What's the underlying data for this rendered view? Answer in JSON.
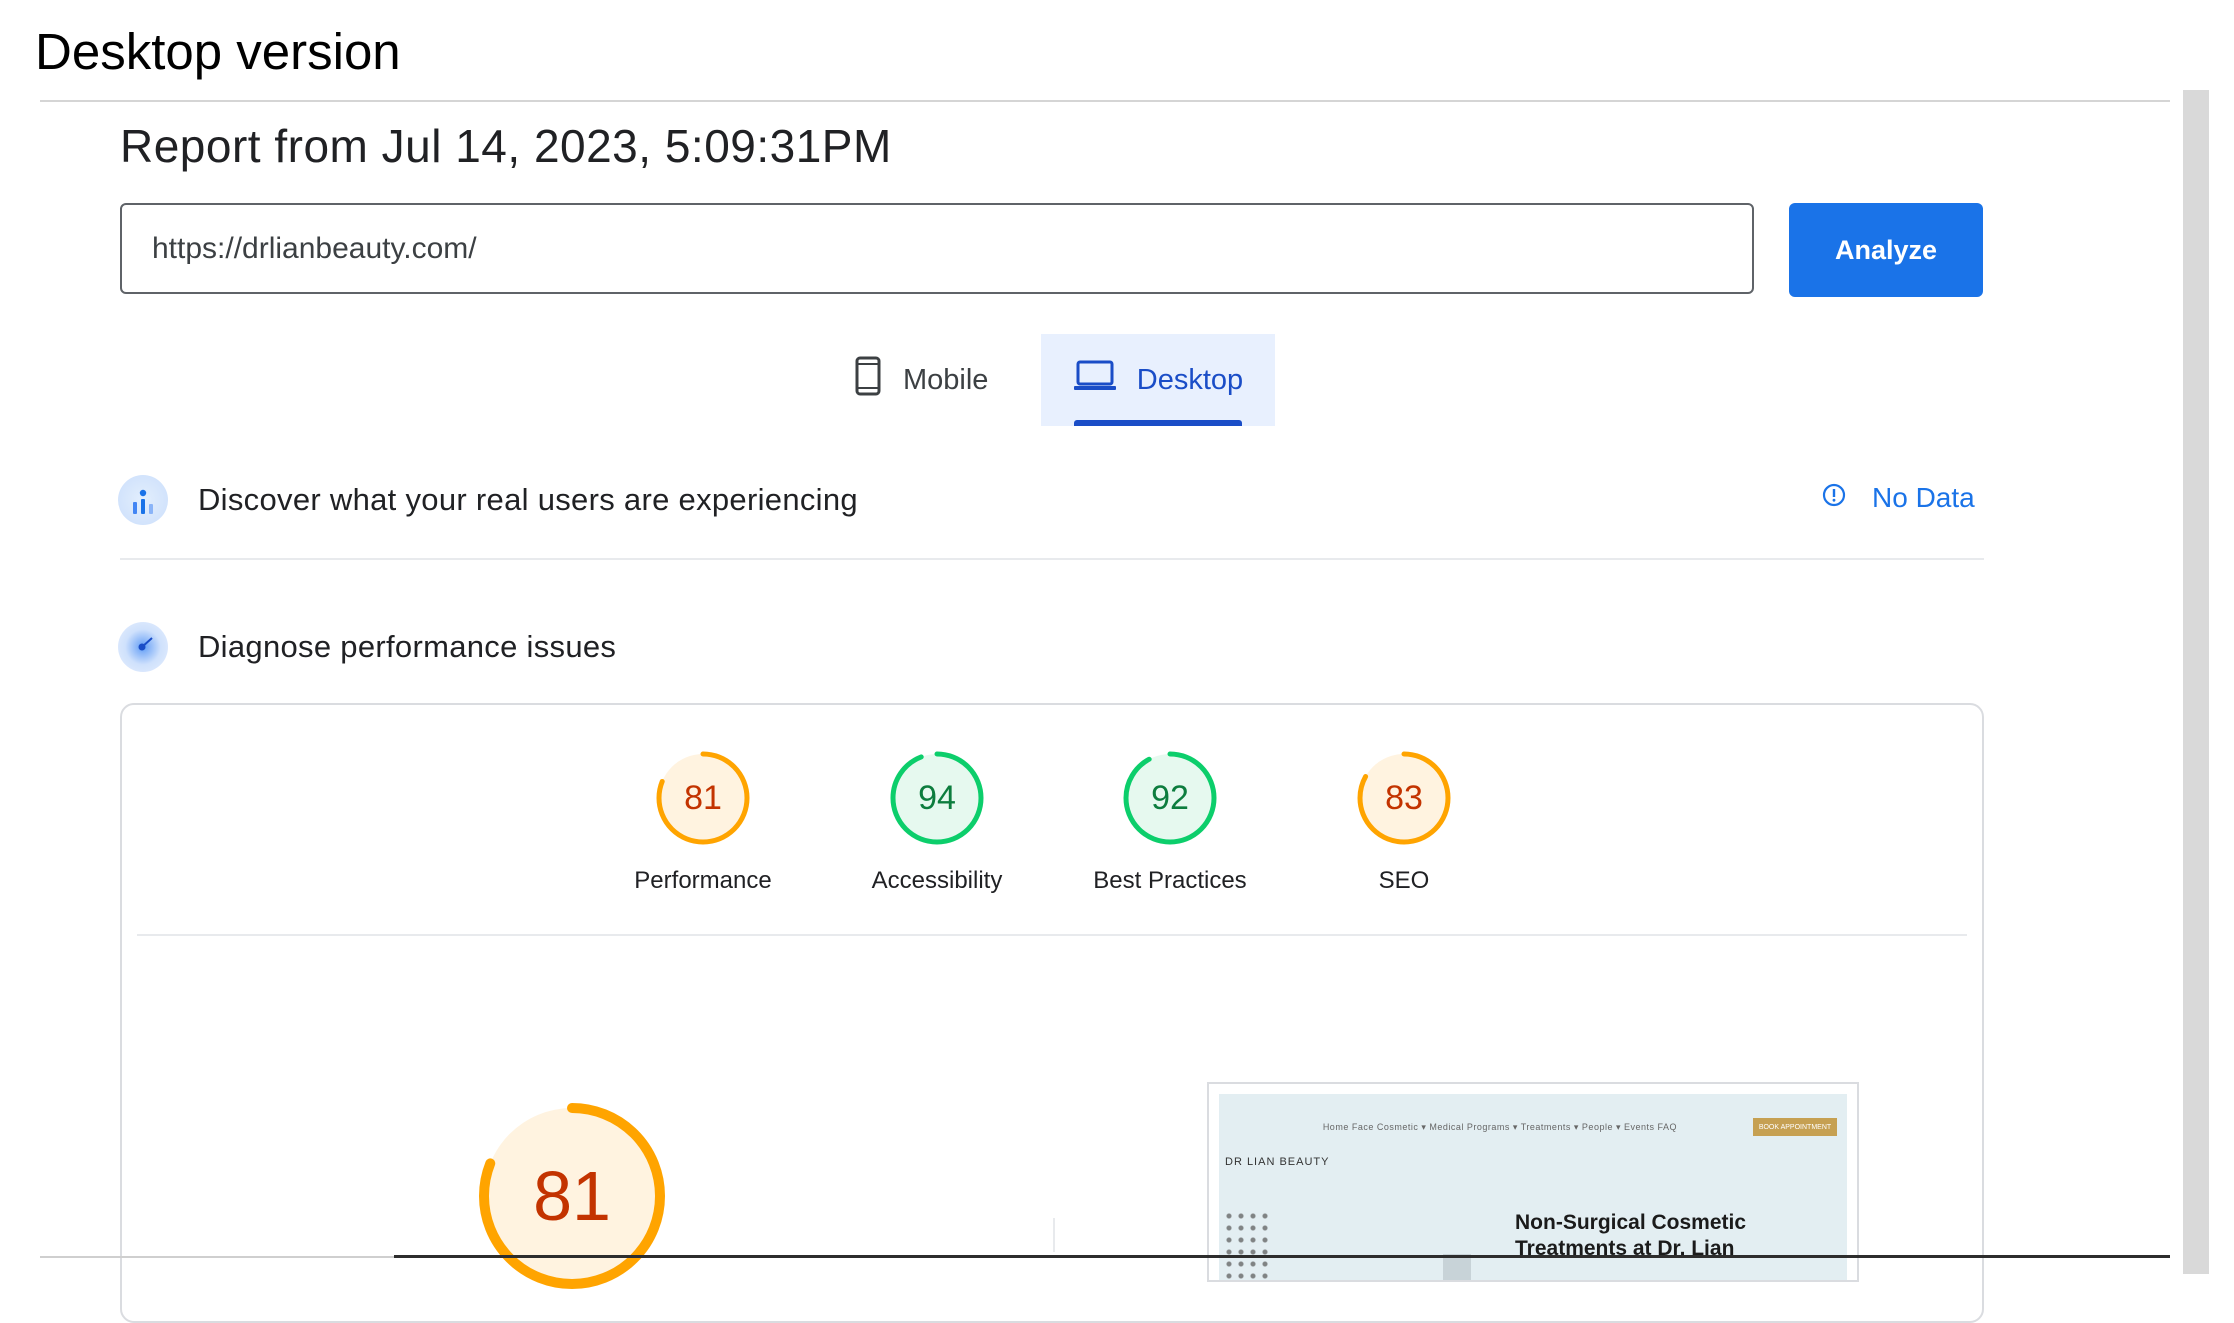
{
  "caption": "Desktop version",
  "report": {
    "title": "Report from Jul 14, 2023, 5:09:31PM",
    "url_value": "https://drlianbeauty.com/",
    "analyze_label": "Analyze"
  },
  "tabs": [
    {
      "label": "Mobile",
      "icon": "phone-icon",
      "selected": false
    },
    {
      "label": "Desktop",
      "icon": "laptop-icon",
      "selected": true
    }
  ],
  "crux": {
    "title": "Discover what your real users are experiencing",
    "status_icon": "info-icon",
    "status": "No Data"
  },
  "diagnose": {
    "title": "Diagnose performance issues"
  },
  "scores": [
    {
      "label": "Performance",
      "value": "81",
      "color": "#c33300",
      "ring": "#ffa400"
    },
    {
      "label": "Accessibility",
      "value": "94",
      "color": "#0d7d3e",
      "ring": "#0cce6b"
    },
    {
      "label": "Best Practices",
      "value": "92",
      "color": "#0d7d3e",
      "ring": "#0cce6b"
    },
    {
      "label": "SEO",
      "value": "83",
      "color": "#c33300",
      "ring": "#ffa400"
    }
  ],
  "performance_detail": {
    "score": "81",
    "ring_color": "#ffa400",
    "text_color": "#c33300"
  },
  "screenshot": {
    "nav": "Home  Face  Cosmetic ▾  Medical Programs ▾  Treatments ▾  People ▾  Events  FAQ",
    "cta": "BOOK APPOINTMENT",
    "brand": "DR LIAN BEAUTY",
    "headline_line1": "Non-Surgical Cosmetic",
    "headline_line2": "Treatments at Dr. Lian"
  },
  "colors": {
    "accent": "#1a73e8",
    "tab_selected_bg": "#e8f0fe",
    "average": "#ffa400",
    "pass": "#0cce6b"
  }
}
